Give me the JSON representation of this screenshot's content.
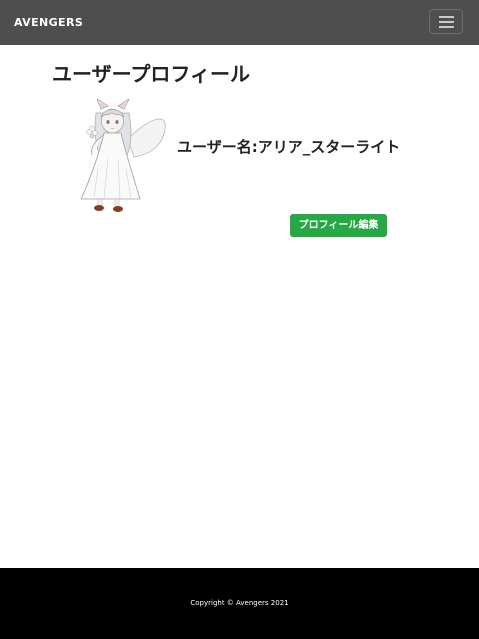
{
  "navbar": {
    "brand": "AVENGERS",
    "menu_icon": "hamburger-menu-icon"
  },
  "profile": {
    "title": "ユーザープロフィール",
    "username_label": "ユーザー名:アリア_スターライト",
    "edit_button_label": "プロフィール編集",
    "edit_button_color": "#28a745",
    "avatar": "character-illustration"
  },
  "footer": {
    "copyright": "Copyright © Avengers 2021"
  }
}
